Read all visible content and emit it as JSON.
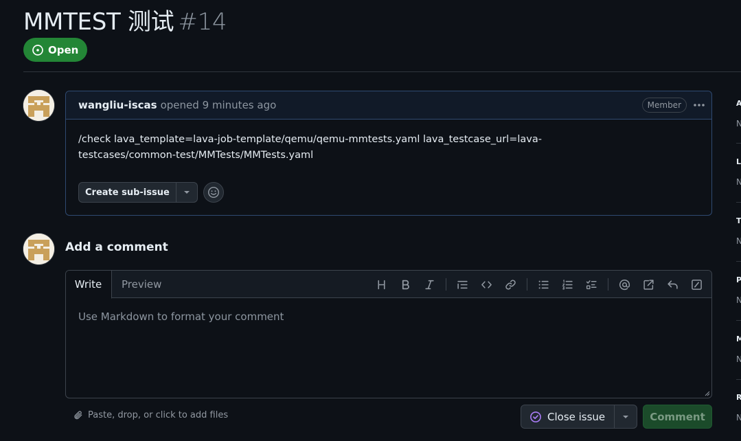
{
  "issue": {
    "title": "MMTEST 测试",
    "number": "#14",
    "state_label": "Open"
  },
  "comment": {
    "author": "wangliu-iscas",
    "action": "opened",
    "time": "9 minutes ago",
    "badge": "Member",
    "body": "/check lava_template=lava-job-template/qemu/qemu-mmtests.yaml lava_testcase_url=lava-testcases/common-test/MMTests/MMTests.yaml",
    "create_sub_issue_label": "Create sub-issue"
  },
  "composer": {
    "heading": "Add a comment",
    "tabs": [
      "Write",
      "Preview"
    ],
    "placeholder": "Use Markdown to format your comment",
    "attach_hint": "Paste, drop, or click to add files",
    "close_label": "Close issue",
    "comment_label": "Comment"
  },
  "sidebar": {
    "sections": [
      "A",
      "L",
      "T",
      "P",
      "M",
      "R"
    ],
    "values": [
      "N",
      "N",
      "N",
      "N",
      "N",
      "N"
    ]
  },
  "colors": {
    "open_green": "#238636",
    "close_purple": "#ab7df8",
    "comment_disabled": "#1b4b2a"
  }
}
